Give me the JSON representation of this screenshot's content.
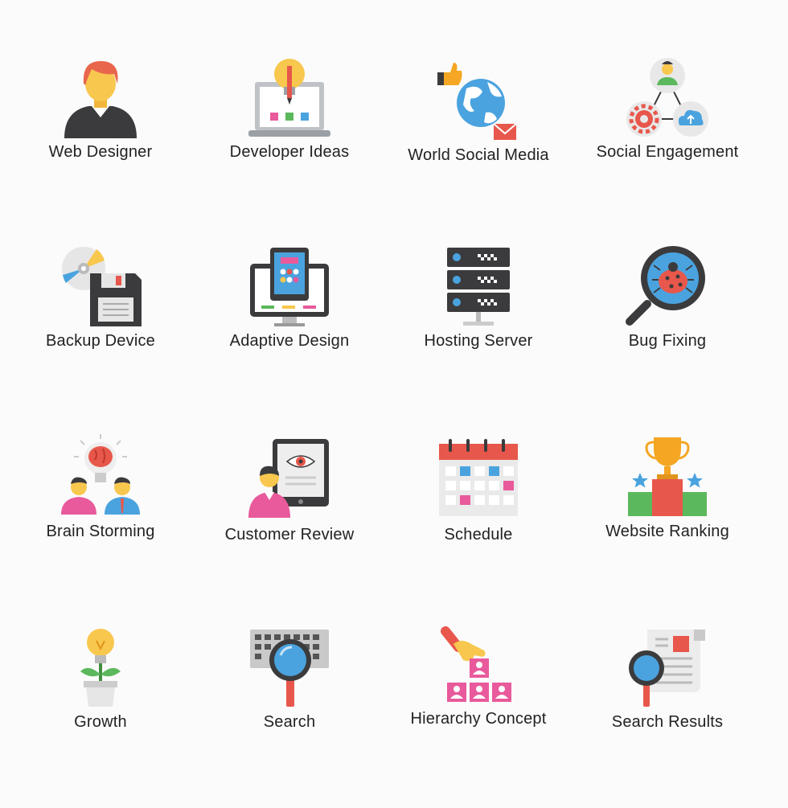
{
  "icons": [
    {
      "label": "Web Designer",
      "icon": "web-designer-icon"
    },
    {
      "label": "Developer Ideas",
      "icon": "developer-ideas-icon"
    },
    {
      "label": "World Social Media",
      "icon": "world-social-media-icon"
    },
    {
      "label": "Social Engagement",
      "icon": "social-engagement-icon"
    },
    {
      "label": "Backup Device",
      "icon": "backup-device-icon"
    },
    {
      "label": "Adaptive Design",
      "icon": "adaptive-design-icon"
    },
    {
      "label": "Hosting Server",
      "icon": "hosting-server-icon"
    },
    {
      "label": "Bug Fixing",
      "icon": "bug-fixing-icon"
    },
    {
      "label": "Brain Storming",
      "icon": "brain-storming-icon"
    },
    {
      "label": "Customer Review",
      "icon": "customer-review-icon"
    },
    {
      "label": "Schedule",
      "icon": "schedule-icon"
    },
    {
      "label": "Website Ranking",
      "icon": "website-ranking-icon"
    },
    {
      "label": "Growth",
      "icon": "growth-icon"
    },
    {
      "label": "Search",
      "icon": "search-icon"
    },
    {
      "label": "Hierarchy Concept",
      "icon": "hierarchy-concept-icon"
    },
    {
      "label": "Search Results",
      "icon": "search-results-icon"
    }
  ],
  "colors": {
    "dark": "#3b3b3d",
    "yellow": "#f8c74e",
    "blue": "#4aa3df",
    "red": "#e8574b",
    "pink": "#e85a9b",
    "green": "#5cb85c"
  }
}
